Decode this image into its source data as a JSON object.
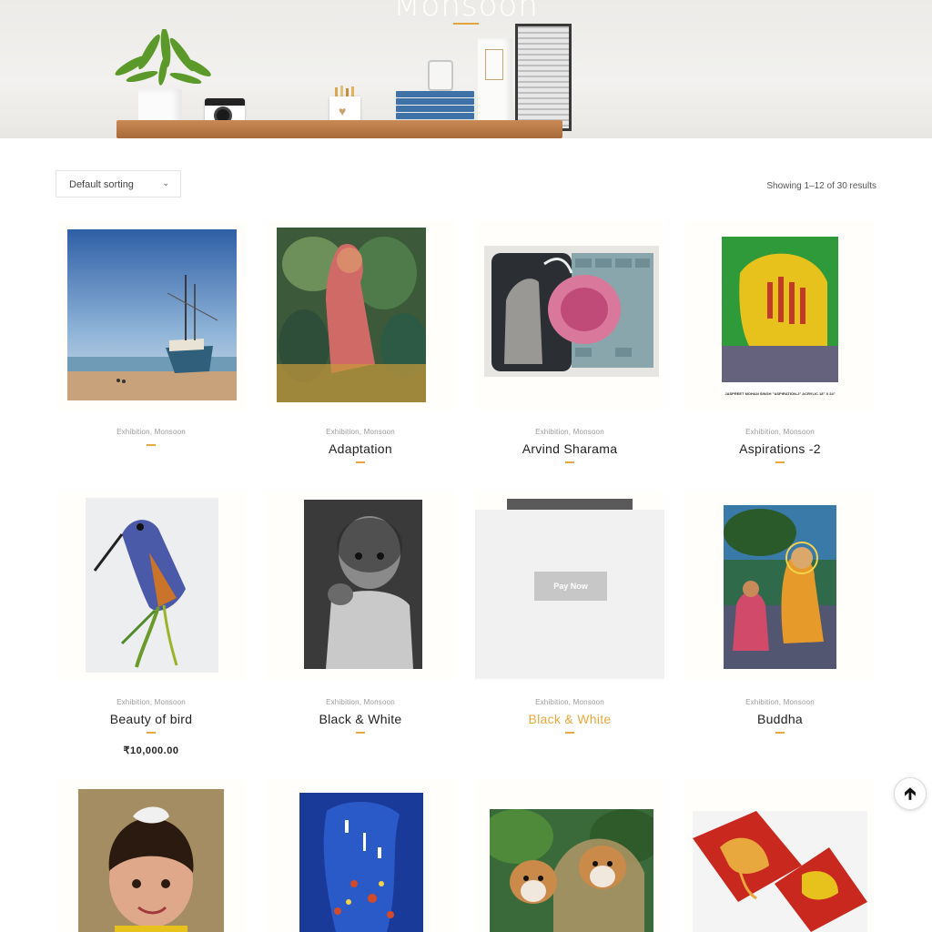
{
  "hero": {
    "title": "Monsoon"
  },
  "toolbar": {
    "sort_label": "Default sorting",
    "results_text": "Showing 1–12 of 30 results"
  },
  "products": [
    {
      "cat1": "Exhibition",
      "cat2": "Monsoon",
      "title": "",
      "price": ""
    },
    {
      "cat1": "Exhibition",
      "cat2": "Monsoon",
      "title": "Adaptation",
      "price": ""
    },
    {
      "cat1": "Exhibition",
      "cat2": "Monsoon",
      "title": "Arvind Sharama",
      "price": ""
    },
    {
      "cat1": "Exhibition",
      "cat2": "Monsoon",
      "title": "Aspirations -2",
      "price": "",
      "caption": "JASPREET MOHAN SINGH \"ASPIRATION-2\" ACRYLIC 18\" X 24\""
    },
    {
      "cat1": "Exhibition",
      "cat2": "Monsoon",
      "title": "Beauty of bird",
      "price": "₹10,000.00"
    },
    {
      "cat1": "Exhibition",
      "cat2": "Monsoon",
      "title": "Black & White",
      "price": ""
    },
    {
      "cat1": "Exhibition",
      "cat2": "Monsoon",
      "title": "Black & White",
      "price": "",
      "button": "Pay Now"
    },
    {
      "cat1": "Exhibition",
      "cat2": "Monsoon",
      "title": "Buddha",
      "price": ""
    },
    {
      "cat1": "",
      "cat2": "",
      "title": "",
      "price": ""
    },
    {
      "cat1": "",
      "cat2": "",
      "title": "",
      "price": ""
    },
    {
      "cat1": "",
      "cat2": "",
      "title": "",
      "price": ""
    },
    {
      "cat1": "",
      "cat2": "",
      "title": "",
      "price": ""
    }
  ],
  "colors": {
    "accent": "#e8a83e",
    "text": "#222222",
    "meta": "#9a9a9a"
  },
  "icons": {
    "scroll_top": "arrow-up-icon",
    "sort_chevron": "chevron-down-icon"
  }
}
